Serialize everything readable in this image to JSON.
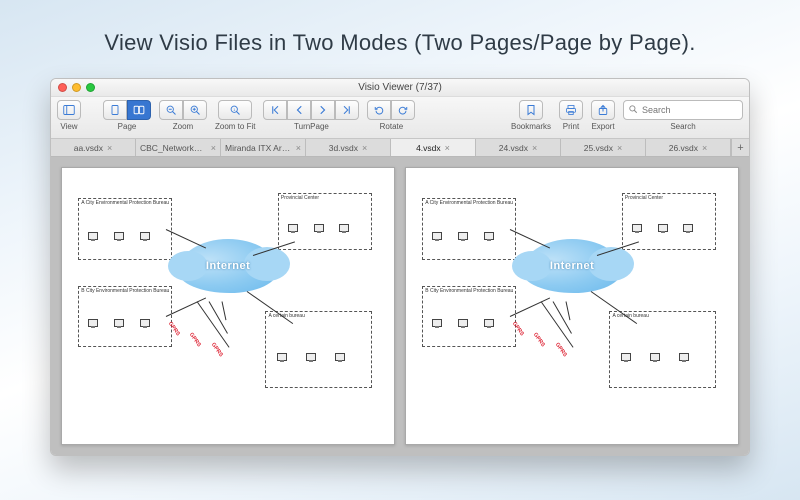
{
  "headline": "View Visio Files in Two Modes (Two Pages/Page by Page).",
  "window": {
    "title": "Visio Viewer (7/37)"
  },
  "toolbar": {
    "groups": {
      "view": "View",
      "page": "Page",
      "zoom": "Zoom",
      "zoom_to_fit": "Zoom to Fit",
      "turn_page": "TurnPage",
      "rotate": "Rotate",
      "bookmarks": "Bookmarks",
      "print": "Print",
      "export": "Export",
      "search": "Search"
    },
    "search_placeholder": "Search"
  },
  "tabs": [
    {
      "label": "aa.vsdx"
    },
    {
      "label": "CBC_Network_Infr…"
    },
    {
      "label": "Miranda ITX Archi…"
    },
    {
      "label": "3d.vsdx"
    },
    {
      "label": "4.vsdx",
      "active": true
    },
    {
      "label": "24.vsdx"
    },
    {
      "label": "25.vsdx"
    },
    {
      "label": "26.vsdx"
    }
  ],
  "diagram": {
    "cloud": "Internet",
    "boxes": {
      "top_left": "A City Environmental Protection Bureau",
      "bottom_left": "B City Environmental Protection Bureau",
      "top_right": "Provincial Center",
      "bottom_right": "A certain bureau"
    },
    "redlabels": [
      "GPRS",
      "GPRS",
      "GPRS"
    ]
  }
}
